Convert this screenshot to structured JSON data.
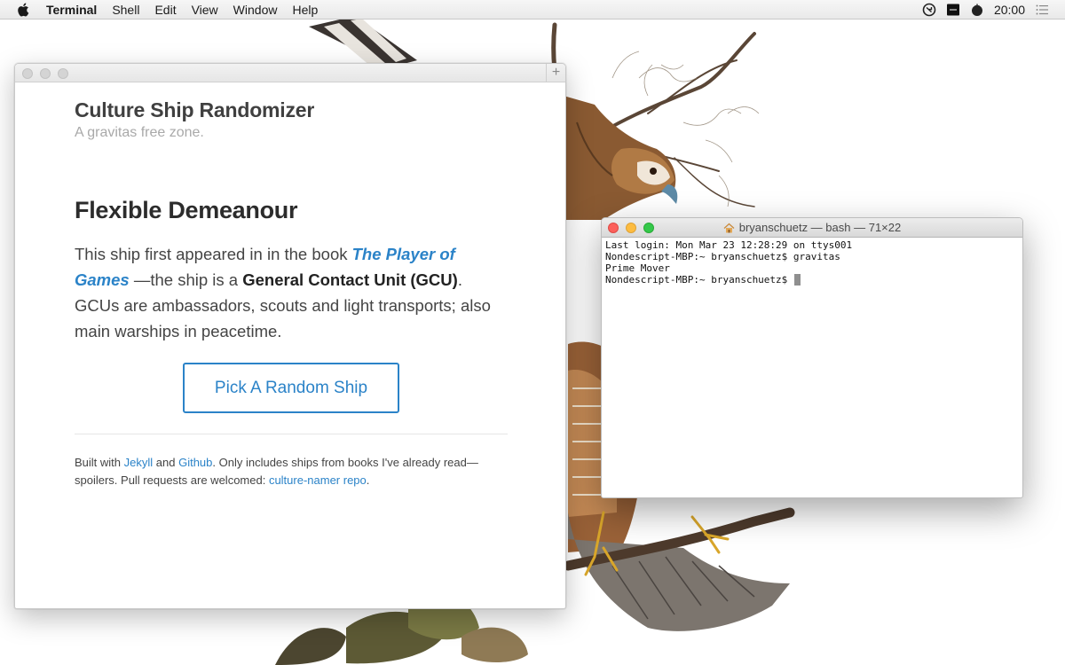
{
  "menubar": {
    "apple_icon": "apple-logo-icon",
    "app_name": "Terminal",
    "menus": [
      "Shell",
      "Edit",
      "View",
      "Window",
      "Help"
    ],
    "clock": "20:00"
  },
  "browser": {
    "new_tab_label": "+",
    "site_title": "Culture Ship Randomizer",
    "tagline": "A gravitas free zone.",
    "ship_name": "Flexible Demeanour",
    "desc_intro": "This ship first appeared in in the book ",
    "book_title": "The Player of Games",
    "desc_mid": " —the ship is a ",
    "ship_class": "General Contact Unit (GCU)",
    "desc_end": ". GCUs are ambassadors, scouts and light transports; also main warships in peacetime.",
    "button_label": "Pick A Random Ship",
    "footer": {
      "t1": "Built with ",
      "link_jekyll": "Jekyll",
      "t2": " and ",
      "link_github": "Github",
      "t3": ". Only includes ships from books I've already read—spoilers. Pull requests are welcomed: ",
      "link_repo": "culture-namer repo",
      "t4": "."
    },
    "accent_color": "#2b83c8"
  },
  "terminal": {
    "title": "bryanschuetz — bash — 71×22",
    "lines": [
      "Last login: Mon Mar 23 12:28:29 on ttys001",
      "Nondescript-MBP:~ bryanschuetz$ gravitas",
      "Prime Mover",
      "Nondescript-MBP:~ bryanschuetz$ "
    ]
  }
}
